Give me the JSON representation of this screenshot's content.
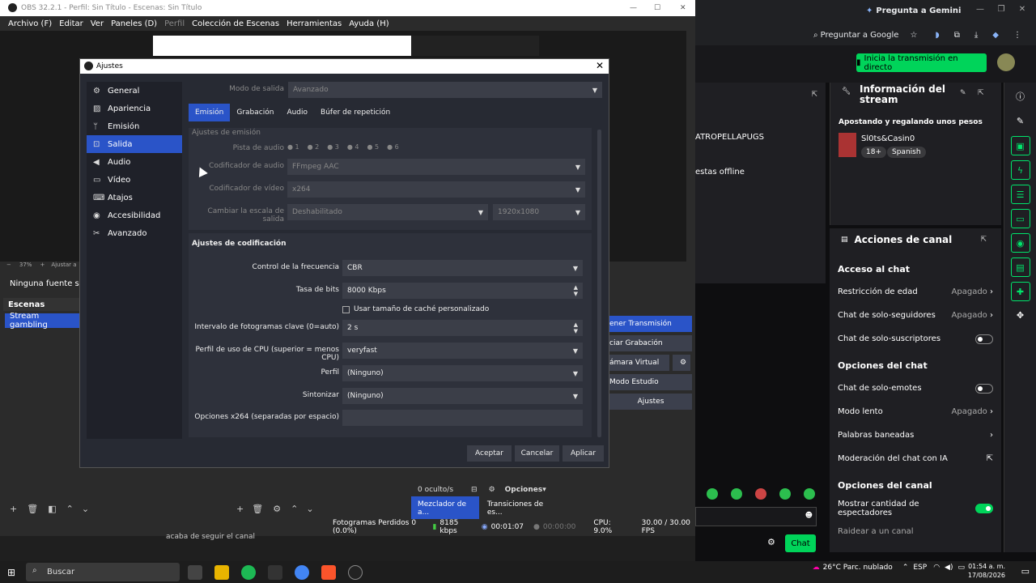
{
  "browser": {
    "gemini_label": "Pregunta a Gemini",
    "ask_google": "Preguntar a Google",
    "live_button": "Inicia la transmisión en directo",
    "stream_partial_1": "ATROPELLAPUGS",
    "stream_partial_2": "estas offline",
    "info_panel_title": "Información del stream",
    "stream_title": "Apostando y regalando unos pesos",
    "category": "Sl0ts&Casin0",
    "tag_18": "18+",
    "tag_lang": "Spanish",
    "actions_title": "Acciones de canal",
    "chat_access": "Acceso al chat",
    "age_restriction": "Restricción de edad",
    "age_restriction_val": "Apagado",
    "followers_chat": "Chat de solo-seguidores",
    "followers_chat_val": "Apagado",
    "subs_chat": "Chat de solo-suscriptores",
    "chat_options": "Opciones del chat",
    "emotes_chat": "Chat de solo-emotes",
    "slow_mode": "Modo lento",
    "slow_mode_val": "Apagado",
    "banned_words": "Palabras baneadas",
    "ai_moderation": "Moderación del chat con IA",
    "channel_options": "Opciones del canal",
    "show_viewers": "Mostrar cantidad de espectadores",
    "raid": "Raidear a un canal",
    "chat_button": "Chat"
  },
  "obs": {
    "title": "OBS 32.2.1 - Perfil: Sin Título - Escenas: Sin Título",
    "menu": [
      "Archivo (F)",
      "Editar",
      "Ver",
      "Paneles (D)",
      "Perfil",
      "Colección de Escenas",
      "Herramientas",
      "Ayuda (H)"
    ],
    "no_source": "Ninguna fuente selecc",
    "scenes_header": "Escenas",
    "scene_1": "Stream gambling",
    "controls": [
      "ener Transmisión",
      "ciar Grabación",
      "ámara Virtual",
      "Modo Estudio",
      "Ajustes"
    ],
    "hidden_count": "0 oculto/s",
    "options_label": "Opciones",
    "mixer_tab": "Mezclador de a...",
    "transitions_tab": "Transiciones de es...",
    "follow_notice": "acaba de seguir el canal",
    "status": {
      "dropped": "Fotogramas Perdidos 0 (0.0%)",
      "bitrate": "8185 kbps",
      "time1": "00:01:07",
      "time2": "00:00:00",
      "cpu": "CPU: 9.0%",
      "fps": "30.00 / 30.00 FPS"
    },
    "zoom": "37%",
    "adjust": "Ajustar a"
  },
  "dialog": {
    "title": "Ajustes",
    "nav": [
      {
        "label": "General",
        "icon": "gear-icon"
      },
      {
        "label": "Apariencia",
        "icon": "palette-icon"
      },
      {
        "label": "Emisión",
        "icon": "antenna-icon"
      },
      {
        "label": "Salida",
        "icon": "output-icon"
      },
      {
        "label": "Audio",
        "icon": "speaker-icon"
      },
      {
        "label": "Vídeo",
        "icon": "monitor-icon"
      },
      {
        "label": "Atajos",
        "icon": "keyboard-icon"
      },
      {
        "label": "Accesibilidad",
        "icon": "accessibility-icon"
      },
      {
        "label": "Avanzado",
        "icon": "tools-icon"
      }
    ],
    "output_mode_label": "Modo de salida",
    "output_mode_value": "Avanzado",
    "tabs": [
      "Emisión",
      "Grabación",
      "Audio",
      "Búfer de repetición"
    ],
    "emission_group": "Ajustes de emisión",
    "audio_track_label": "Pista de audio",
    "audio_tracks": [
      "1",
      "2",
      "3",
      "4",
      "5",
      "6"
    ],
    "audio_encoder_label": "Codificador de audio",
    "audio_encoder_value": "FFmpeg AAC",
    "video_encoder_label": "Codificador de vídeo",
    "video_encoder_value": "x264",
    "rescale_label": "Cambiar la escala de salida",
    "rescale_value": "Deshabilitado",
    "rescale_res": "1920x1080",
    "encoding_group": "Ajustes de codificación",
    "rate_control_label": "Control de la frecuencia",
    "rate_control_value": "CBR",
    "bitrate_label": "Tasa de bits",
    "bitrate_value": "8000 Kbps",
    "custom_cache": "Usar tamaño de caché personalizado",
    "keyframe_label": "Intervalo de fotogramas clave (0=auto)",
    "keyframe_value": "2 s",
    "cpu_preset_label": "Perfil de uso de CPU (superior = menos CPU)",
    "cpu_preset_value": "veryfast",
    "profile_label": "Perfil",
    "profile_value": "(Ninguno)",
    "tune_label": "Sintonizar",
    "tune_value": "(Ninguno)",
    "x264_opts_label": "Opciones x264 (separadas por espacio)",
    "x264_opts_value": "",
    "accept": "Aceptar",
    "cancel": "Cancelar",
    "apply": "Aplicar"
  },
  "taskbar": {
    "search": "Buscar",
    "weather": "26°C  Parc. nublado",
    "lang": "ESP",
    "time": "01:54 a. m.",
    "date": "17/08/2026"
  }
}
